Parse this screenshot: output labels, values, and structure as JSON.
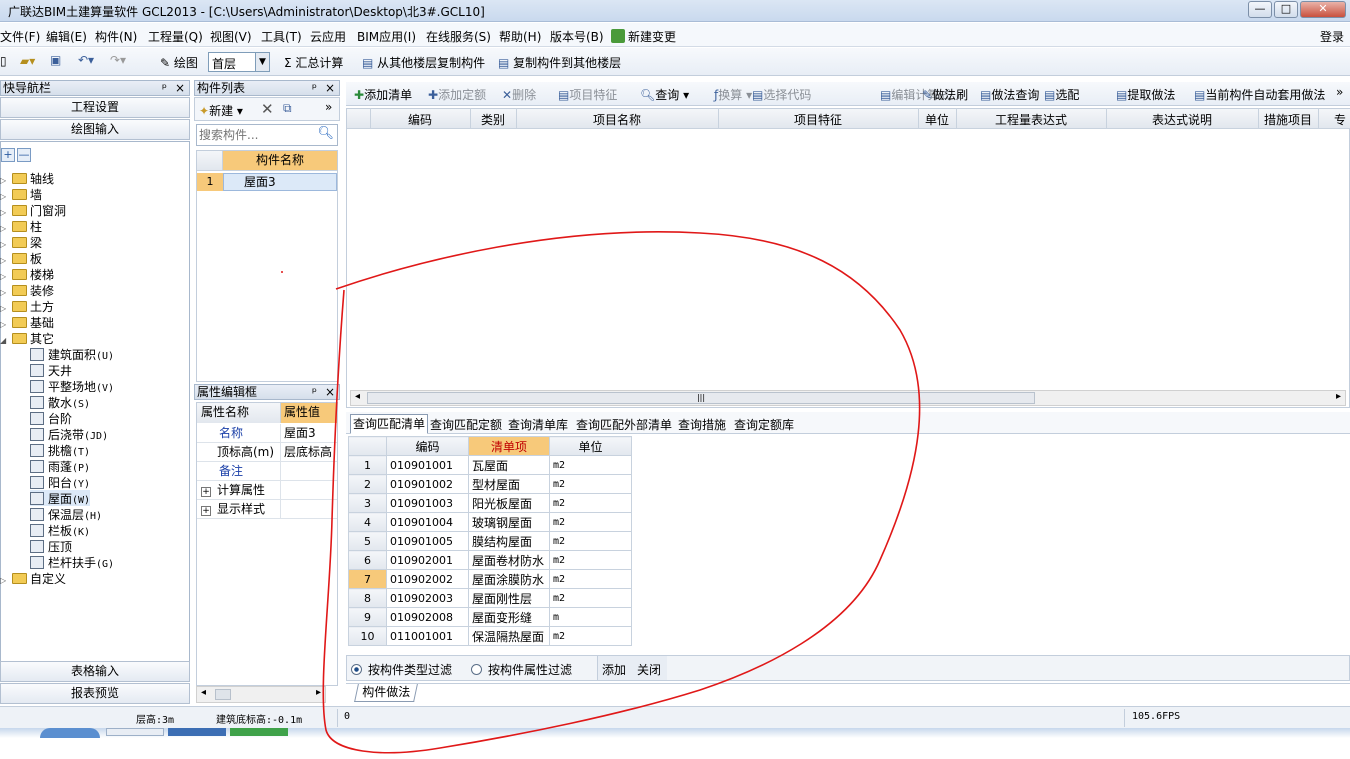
{
  "window": {
    "title": "广联达BIM土建算量软件 GCL2013 - [C:\\Users\\Administrator\\Desktop\\北3#.GCL10]",
    "min": "—",
    "max": "□",
    "close": "✕"
  },
  "menu": {
    "items": [
      "文件(F)",
      "编辑(E)",
      "构件(N)",
      "工程量(Q)",
      "视图(V)",
      "工具(T)",
      "云应用",
      "BIM应用(I)",
      "在线服务(S)",
      "帮助(H)",
      "版本号(B)",
      "新建变更"
    ],
    "login": "登录"
  },
  "toolbar": {
    "draw": "绘图",
    "floor": "首层",
    "sum": "汇总计算",
    "copy_from": "从其他楼层复制构件",
    "copy_to": "复制构件到其他楼层"
  },
  "nav": {
    "title": "快导航栏",
    "project_settings": "工程设置",
    "drawing_input": "绘图输入",
    "tree": [
      "轴线",
      "墙",
      "门窗洞",
      "柱",
      "梁",
      "板",
      "楼梯",
      "装修",
      "土方",
      "基础",
      "其它"
    ],
    "children": [
      {
        "label": "建筑面积",
        "key": "(U)"
      },
      {
        "label": "天井",
        "key": ""
      },
      {
        "label": "平整场地",
        "key": "(V)"
      },
      {
        "label": "散水",
        "key": "(S)"
      },
      {
        "label": "台阶",
        "key": ""
      },
      {
        "label": "后浇带",
        "key": "(JD)"
      },
      {
        "label": "挑檐",
        "key": "(T)"
      },
      {
        "label": "雨蓬",
        "key": "(P)"
      },
      {
        "label": "阳台",
        "key": "(Y)"
      },
      {
        "label": "屋面",
        "key": "(W)"
      },
      {
        "label": "保温层",
        "key": "(H)"
      },
      {
        "label": "栏板",
        "key": "(K)"
      },
      {
        "label": "压顶",
        "key": ""
      },
      {
        "label": "栏杆扶手",
        "key": "(G)"
      }
    ],
    "custom": "自定义",
    "table_input": "表格输入",
    "report_preview": "报表预览"
  },
  "component_list": {
    "title": "构件列表",
    "new": "新建",
    "search_placeholder": "搜索构件...",
    "col": "构件名称",
    "rows": [
      {
        "n": "1",
        "name": "屋面3"
      }
    ]
  },
  "props": {
    "title": "属性编辑框",
    "col_name": "属性名称",
    "col_value": "属性值",
    "rows": [
      {
        "name": "名称",
        "value": "屋面3"
      },
      {
        "name": "顶标高(m)",
        "value": "层底标高"
      },
      {
        "name": "备注",
        "value": ""
      },
      {
        "name": "计算属性",
        "value": ""
      },
      {
        "name": "显示样式",
        "value": ""
      }
    ]
  },
  "right_toolbar": {
    "items": [
      "添加清单",
      "添加定额",
      "删除",
      "项目特征",
      "查询",
      "换算",
      "选择代码",
      "编辑计算式",
      "做法刷",
      "做法查询",
      "选配",
      "提取做法",
      "当前构件自动套用做法"
    ]
  },
  "upper_grid": {
    "headers": [
      "编码",
      "类别",
      "项目名称",
      "项目特征",
      "单位",
      "工程量表达式",
      "表达式说明",
      "措施项目",
      "专"
    ]
  },
  "lower_tabs": [
    "查询匹配清单",
    "查询匹配定额",
    "查询清单库",
    "查询匹配外部清单",
    "查询措施",
    "查询定额库"
  ],
  "lower_grid": {
    "headers": [
      "编码",
      "清单项",
      "单位"
    ],
    "rows": [
      {
        "n": "1",
        "code": "010901001",
        "name": "瓦屋面",
        "unit": "m2"
      },
      {
        "n": "2",
        "code": "010901002",
        "name": "型材屋面",
        "unit": "m2"
      },
      {
        "n": "3",
        "code": "010901003",
        "name": "阳光板屋面",
        "unit": "m2"
      },
      {
        "n": "4",
        "code": "010901004",
        "name": "玻璃钢屋面",
        "unit": "m2"
      },
      {
        "n": "5",
        "code": "010901005",
        "name": "膜结构屋面",
        "unit": "m2"
      },
      {
        "n": "6",
        "code": "010902001",
        "name": "屋面卷材防水",
        "unit": "m2"
      },
      {
        "n": "7",
        "code": "010902002",
        "name": "屋面涂膜防水",
        "unit": "m2"
      },
      {
        "n": "8",
        "code": "010902003",
        "name": "屋面刚性层",
        "unit": "m2"
      },
      {
        "n": "9",
        "code": "010902008",
        "name": "屋面变形缝",
        "unit": "m"
      },
      {
        "n": "10",
        "code": "011001001",
        "name": "保温隔热屋面",
        "unit": "m2"
      }
    ],
    "filter1": "按构件类型过滤",
    "filter2": "按构件属性过滤",
    "add": "添加",
    "close": "关闭",
    "bottom_tab": "构件做法"
  },
  "status": {
    "floor_height": "层高:3m",
    "base_elev": "建筑底标高:-0.1m",
    "zero": "0",
    "fps": "105.6FPS"
  },
  "colors": {
    "annotation": "#e01818",
    "highlight": "#f7c97a",
    "selected": "#dce9f8"
  }
}
